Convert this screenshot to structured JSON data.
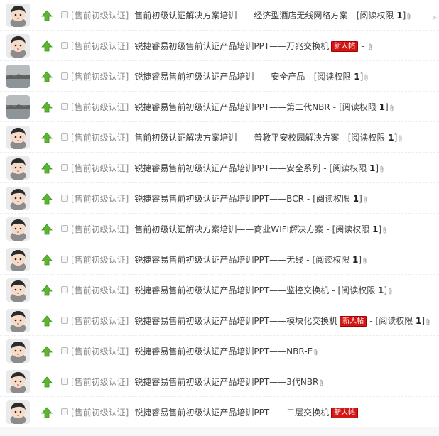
{
  "rows": [
    {
      "avatar": "cartoon",
      "category": "[售前初级认证]",
      "title": "售前初级认证解决方案培训——经济型酒店无线网络方案",
      "badge": "",
      "permission_label": "[阅读权限 ",
      "permission_value": "1",
      "permission_close": "]",
      "show_permission": true,
      "attachment": true
    },
    {
      "avatar": "cartoon",
      "category": "[售前初级认证]",
      "title": "锐捷睿易初级售前认证产品培训PPT——万兆交换机",
      "badge": "新人帖",
      "permission_label": "",
      "permission_value": "",
      "permission_close": "",
      "show_permission": false,
      "attachment": true
    },
    {
      "avatar": "photo",
      "category": "[售前初级认证]",
      "title": "锐捷睿易售前初级认证产品培训——安全产品",
      "badge": "",
      "permission_label": "[阅读权限 ",
      "permission_value": "1",
      "permission_close": "]",
      "show_permission": true,
      "attachment": true
    },
    {
      "avatar": "photo",
      "category": "[售前初级认证]",
      "title": "锐捷睿易售前初级认证产品培训PPT——第二代NBR",
      "badge": "",
      "permission_label": "[阅读权限 ",
      "permission_value": "1",
      "permission_close": "]",
      "show_permission": true,
      "attachment": true
    },
    {
      "avatar": "cartoon",
      "category": "[售前初级认证]",
      "title": "售前初级认证解决方案培训——普教平安校园解决方案",
      "badge": "",
      "permission_label": "[阅读权限 ",
      "permission_value": "1",
      "permission_close": "]",
      "show_permission": true,
      "attachment": true
    },
    {
      "avatar": "cartoon",
      "category": "[售前初级认证]",
      "title": "锐捷睿易售前初级认证产品培训PPT——安全系列",
      "badge": "",
      "permission_label": "[阅读权限 ",
      "permission_value": "1",
      "permission_close": "]",
      "show_permission": true,
      "attachment": true
    },
    {
      "avatar": "cartoon",
      "category": "[售前初级认证]",
      "title": "锐捷睿易售前初级认证产品培训PPT——BCR",
      "badge": "",
      "permission_label": "[阅读权限 ",
      "permission_value": "1",
      "permission_close": "]",
      "show_permission": true,
      "attachment": true
    },
    {
      "avatar": "cartoon",
      "category": "[售前初级认证]",
      "title": "售前初级认证解决方案培训——商业WIFI解决方案",
      "badge": "",
      "permission_label": "[阅读权限 ",
      "permission_value": "1",
      "permission_close": "]",
      "show_permission": true,
      "attachment": true
    },
    {
      "avatar": "cartoon",
      "category": "[售前初级认证]",
      "title": "锐捷睿易售前初级认证产品培训PPT——无线",
      "badge": "",
      "permission_label": "[阅读权限 ",
      "permission_value": "1",
      "permission_close": "]",
      "show_permission": true,
      "attachment": true
    },
    {
      "avatar": "cartoon",
      "category": "[售前初级认证]",
      "title": "锐捷睿易售前初级认证产品培训PPT——监控交换机",
      "badge": "",
      "permission_label": "[阅读权限 ",
      "permission_value": "1",
      "permission_close": "]",
      "show_permission": true,
      "attachment": true
    },
    {
      "avatar": "cartoon",
      "category": "[售前初级认证]",
      "title": "锐捷睿易售前初级认证产品培训PPT——模块化交换机",
      "badge": "新人帖",
      "permission_label": "[阅读权限 ",
      "permission_value": "1",
      "permission_close": "]",
      "show_permission": true,
      "attachment": true
    },
    {
      "avatar": "cartoon",
      "category": "[售前初级认证]",
      "title": "锐捷睿易售前初级认证产品培训PPT——NBR-E",
      "badge": "",
      "permission_label": "",
      "permission_value": "",
      "permission_close": "",
      "show_permission": false,
      "attachment": true
    },
    {
      "avatar": "cartoon",
      "category": "[售前初级认证]",
      "title": "锐捷睿易售前初级认证产品培训PPT——3代NBR",
      "badge": "",
      "permission_label": "",
      "permission_value": "",
      "permission_close": "",
      "show_permission": false,
      "attachment": true
    },
    {
      "avatar": "cartoon",
      "category": "[售前初级认证]",
      "title": "锐捷睿易售前初级认证产品培训PPT——二层交换机",
      "badge": "新人帖",
      "permission_label": "",
      "permission_value": "",
      "permission_close": "",
      "show_permission": false,
      "attachment": false
    }
  ],
  "colors": {
    "up_arrow": "#5cb531",
    "badge": "#d31717",
    "category": "#8a8a8a",
    "title": "#3b3b3b"
  },
  "icons": {
    "up": "up-arrow-icon",
    "attachment": "paperclip-icon",
    "checkbox": "checkbox"
  }
}
